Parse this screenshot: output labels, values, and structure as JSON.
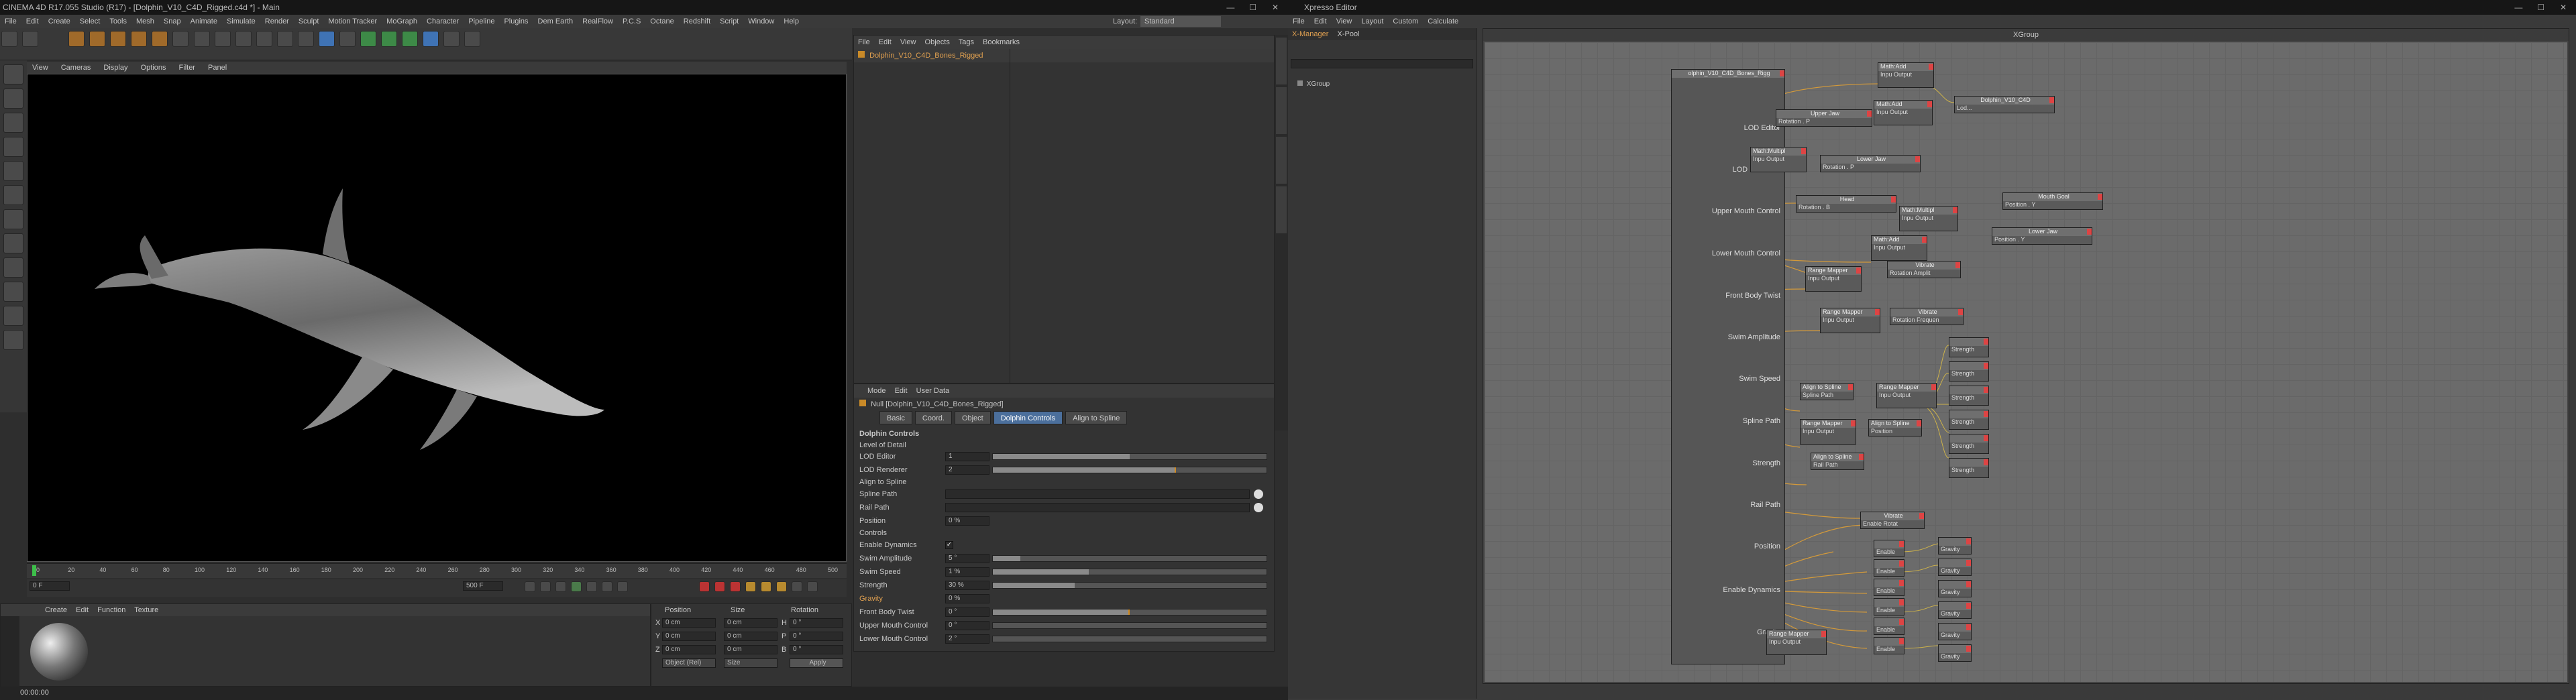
{
  "c4d": {
    "title": "CINEMA 4D R17.055 Studio (R17) - [Dolphin_V10_C4D_Rigged.c4d *] - Main",
    "menu": [
      "File",
      "Edit",
      "Create",
      "Select",
      "Tools",
      "Mesh",
      "Snap",
      "Animate",
      "Simulate",
      "Render",
      "Sculpt",
      "Motion Tracker",
      "MoGraph",
      "Character",
      "Pipeline",
      "Plugins",
      "Dem Earth",
      "RealFlow",
      "P.C.S",
      "Octane",
      "Redshift",
      "Script",
      "Window",
      "Help"
    ],
    "layout_label": "Layout:",
    "layout_value": "Standard",
    "viewport_menu": [
      "View",
      "Cameras",
      "Display",
      "Options",
      "Filter",
      "Panel"
    ],
    "timeline_ticks": [
      "0",
      "20",
      "40",
      "60",
      "80",
      "100",
      "120",
      "140",
      "160",
      "180",
      "200",
      "220",
      "240",
      "260",
      "280",
      "300",
      "320",
      "340",
      "360",
      "380",
      "400",
      "420",
      "440",
      "460",
      "480",
      "500"
    ],
    "current_frame": "0 F",
    "start_frame": "0 F",
    "end_frame": "500 F",
    "material_menu": [
      "Create",
      "Edit",
      "Function",
      "Texture"
    ],
    "coords": {
      "headers": [
        "Position",
        "Size",
        "Rotation"
      ],
      "rows": [
        {
          "axis": "X",
          "pos": "0 cm",
          "size": "0 cm",
          "rot_label": "H",
          "rot": "0 °"
        },
        {
          "axis": "Y",
          "pos": "0 cm",
          "size": "0 cm",
          "rot_label": "P",
          "rot": "0 °"
        },
        {
          "axis": "Z",
          "pos": "0 cm",
          "size": "0 cm",
          "rot_label": "B",
          "rot": "0 °"
        }
      ],
      "mode": "Object (Rel)",
      "size_mode": "Size",
      "apply": "Apply"
    },
    "status_time": "00:00:00",
    "objects": {
      "menu": [
        "File",
        "Edit",
        "View",
        "Objects",
        "Tags",
        "Bookmarks"
      ],
      "item": "Dolphin_V10_C4D_Bones_Rigged"
    },
    "attributes": {
      "menu": [
        "Mode",
        "Edit",
        "User Data"
      ],
      "object_line": "Null [Dolphin_V10_C4D_Bones_Rigged]",
      "tabs": [
        "Basic",
        "Coord.",
        "Object",
        "Dolphin Controls",
        "Align to Spline"
      ],
      "active_tab": "Dolphin Controls",
      "section": "Dolphin Controls",
      "group_lod": "Level of Detail",
      "lod_editor": {
        "label": "LOD Editor",
        "value": "1",
        "level": 0.5
      },
      "lod_renderer": {
        "label": "LOD Renderer",
        "value": "2",
        "level": 0.67
      },
      "group_align": "Align to Spline",
      "spline_path": "Spline Path",
      "rail_path": "Rail Path",
      "position": {
        "label": "Position",
        "value": "0 %"
      },
      "group_controls": "Controls",
      "enable_dynamics": "Enable Dynamics",
      "swim_amplitude": {
        "label": "Swim Amplitude",
        "value": "5 °",
        "level": 0.1
      },
      "swim_speed": {
        "label": "Swim Speed",
        "value": "1 %",
        "level": 0.35
      },
      "strength": {
        "label": "Strength",
        "value": "30 %",
        "level": 0.3
      },
      "gravity": {
        "label": "Gravity",
        "value": "0 %",
        "level": 0
      },
      "front_body_twist": {
        "label": "Front Body Twist",
        "value": "0 °",
        "level": 0.5
      },
      "upper_mouth": {
        "label": "Upper Mouth Control",
        "value": "0 °",
        "level": 0
      },
      "lower_mouth": {
        "label": "Lower Mouth Control",
        "value": "2 °",
        "level": 0
      }
    }
  },
  "xpresso": {
    "title": "Xpresso Editor",
    "menu": [
      "File",
      "Edit",
      "View",
      "Layout",
      "Custom",
      "Calculate"
    ],
    "manager_tabs": [
      "X-Manager",
      "X-Pool"
    ],
    "pool_item": "XGroup",
    "graph_title": "XGroup",
    "main_node": "olphin_V10_C4D_Bones_Rigg",
    "ports": [
      "LOD Editor",
      "LOD Renderer",
      "Upper Mouth Control",
      "Lower Mouth Control",
      "Front Body Twist",
      "Swim Amplitude",
      "Swim Speed",
      "Spline Path",
      "Strength",
      "Rail Path",
      "Position",
      "Enable Dynamics",
      "Gravity"
    ],
    "nodes": [
      {
        "title": "Math:Add",
        "body": "Inpu Output"
      },
      {
        "title": "Dolphin_V10_C4D",
        "body": "Lod..."
      },
      {
        "title": "Upper Jaw",
        "body": "Rotation . P"
      },
      {
        "title": "Math:Add",
        "body": "Inpu Output"
      },
      {
        "title": "Math:Multipl",
        "body": "Inpu Output"
      },
      {
        "title": "Lower Jaw",
        "body": "Rotation . P"
      },
      {
        "title": "Head",
        "body": "Rotation . B"
      },
      {
        "title": "Math:Multipl",
        "body": "Inpu Output"
      },
      {
        "title": "Mouth Goal",
        "body": "Position . Y"
      },
      {
        "title": "Math:Add",
        "body": "Inpu Output"
      },
      {
        "title": "Lower Jaw",
        "body": "Position . Y"
      },
      {
        "title": "Range Mapper",
        "body": "Inpu Output"
      },
      {
        "title": "Vibrate",
        "body": "Rotation Amplit"
      },
      {
        "title": "Range Mapper",
        "body": "Inpu Output"
      },
      {
        "title": "Vibrate",
        "body": "Rotation Frequen"
      },
      {
        "title": "Align to Spline",
        "body": "Spline Path"
      },
      {
        "title": "Range Mapper",
        "body": "Inpu Output"
      },
      {
        "title": "Range Mapper",
        "body": "Inpu Output"
      },
      {
        "title": "Align to Spline",
        "body": "Position"
      },
      {
        "title": "Align to Spline",
        "body": "Rail Path"
      },
      {
        "title": "Vibrate",
        "body": "Enable Rotat"
      },
      {
        "title": "Range Mapper",
        "body": "Inpu Output"
      }
    ],
    "strength_nodes": [
      "Strength",
      "Strength",
      "Strength",
      "Strength",
      "Strength",
      "Strength"
    ],
    "enable_nodes": [
      "Enable",
      "Enable",
      "Enable",
      "Enable",
      "Enable",
      "Enable"
    ],
    "gravity_nodes": [
      "Gravity",
      "Gravity",
      "Gravity",
      "Gravity",
      "Gravity",
      "Gravity"
    ]
  }
}
